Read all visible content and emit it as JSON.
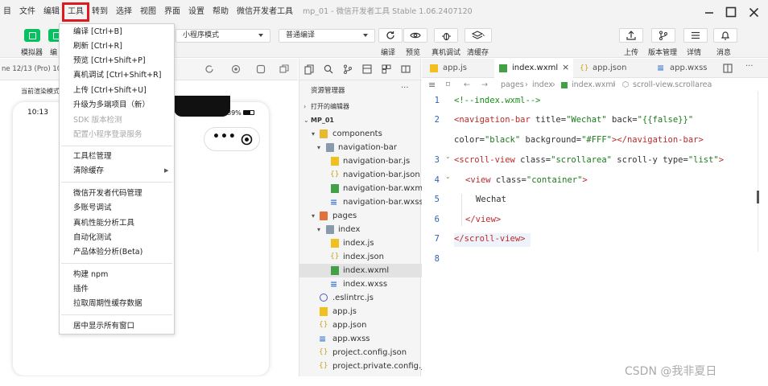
{
  "menubar": {
    "items": [
      "目",
      "文件",
      "编辑",
      "工具",
      "转到",
      "选择",
      "视图",
      "界面",
      "设置",
      "帮助",
      "微信开发者工具"
    ],
    "title": "mp_01 - 微信开发者工具 Stable 1.06.2407120"
  },
  "toolbar": {
    "simulator_label": "模拟器",
    "editor_label": "编",
    "mode_select": "小程序模式",
    "compile_select": "普通编译",
    "compile_label": "编译",
    "preview_label": "预览",
    "remote_debug_label": "真机调试",
    "clear_cache_label": "清缓存",
    "upload_label": "上传",
    "version_label": "版本管理",
    "details_label": "详情",
    "messages_label": "消息"
  },
  "simulator": {
    "device_label": "ne 12/13 (Pro) 10",
    "page_path_label": "当前渲染模式",
    "time": "10:13",
    "battery": "89%"
  },
  "tools_menu": {
    "items": [
      "编译 [Ctrl+B]",
      "刷新 [Ctrl+R]",
      "预览 [Ctrl+Shift+P]",
      "真机调试 [Ctrl+Shift+R]",
      "上传 [Ctrl+Shift+U]",
      "升级为多端项目（新）",
      "SDK 版本检测",
      "配置小程序登录服务",
      "工具栏管理",
      "清除缓存",
      "微信开发者代码管理",
      "多账号调试",
      "真机性能分析工具",
      "自动化测试",
      "产品体验分析(Beta)",
      "构建 npm",
      "插件",
      "拉取周期性缓存数据",
      "居中显示所有窗口"
    ]
  },
  "explorer": {
    "title": "资源管理器",
    "more": "···",
    "open_editors": "打开的编辑器",
    "project": "MP_01",
    "tree": [
      "components",
      "navigation-bar",
      "navigation-bar.js",
      "navigation-bar.json",
      "navigation-bar.wxml",
      "navigation-bar.wxss",
      "pages",
      "index",
      "index.js",
      "index.json",
      "index.wxml",
      "index.wxss",
      ".eslintrc.js",
      "app.js",
      "app.json",
      "app.wxss",
      "project.config.json",
      "project.private.config.js..."
    ]
  },
  "editor": {
    "tabs": [
      "app.js",
      "index.wxml",
      "app.json",
      "app.wxss"
    ],
    "breadcrumb": [
      "pages",
      "index",
      "index.wxml",
      "scroll-view.scrollarea"
    ],
    "line_numbers": [
      "1",
      "2",
      "3",
      "4",
      "5",
      "6",
      "7",
      "8"
    ],
    "code": {
      "l1": "<!--index.wxml-->",
      "l2a": "<navigation-bar",
      "l2b": " title=",
      "l2c": "\"Wechat\"",
      "l2d": " back=",
      "l2e": "\"{{false}}\"",
      "l2f": "color=",
      "l2g": "\"black\"",
      "l2h": " background=",
      "l2i": "\"#FFF\"",
      "l2j": "></navigation-bar>",
      "l3a": "<scroll-view",
      "l3b": " class=",
      "l3c": "\"scrollarea\"",
      "l3d": " scroll-y type=",
      "l3e": "\"list\"",
      "l3f": ">",
      "l4a": "<view",
      "l4b": " class=",
      "l4c": "\"container\"",
      "l4d": ">",
      "l5": "Wechat",
      "l6": "</view>",
      "l7": "</scroll-view>"
    }
  },
  "watermark": "CSDN @我非夏日",
  "colors": {
    "accent_green": "#07c160",
    "highlight_red": "#e0191f",
    "tag_red": "#bb2b2b",
    "string_green": "#1c7a1c",
    "comment_green": "#1a8c1a"
  }
}
